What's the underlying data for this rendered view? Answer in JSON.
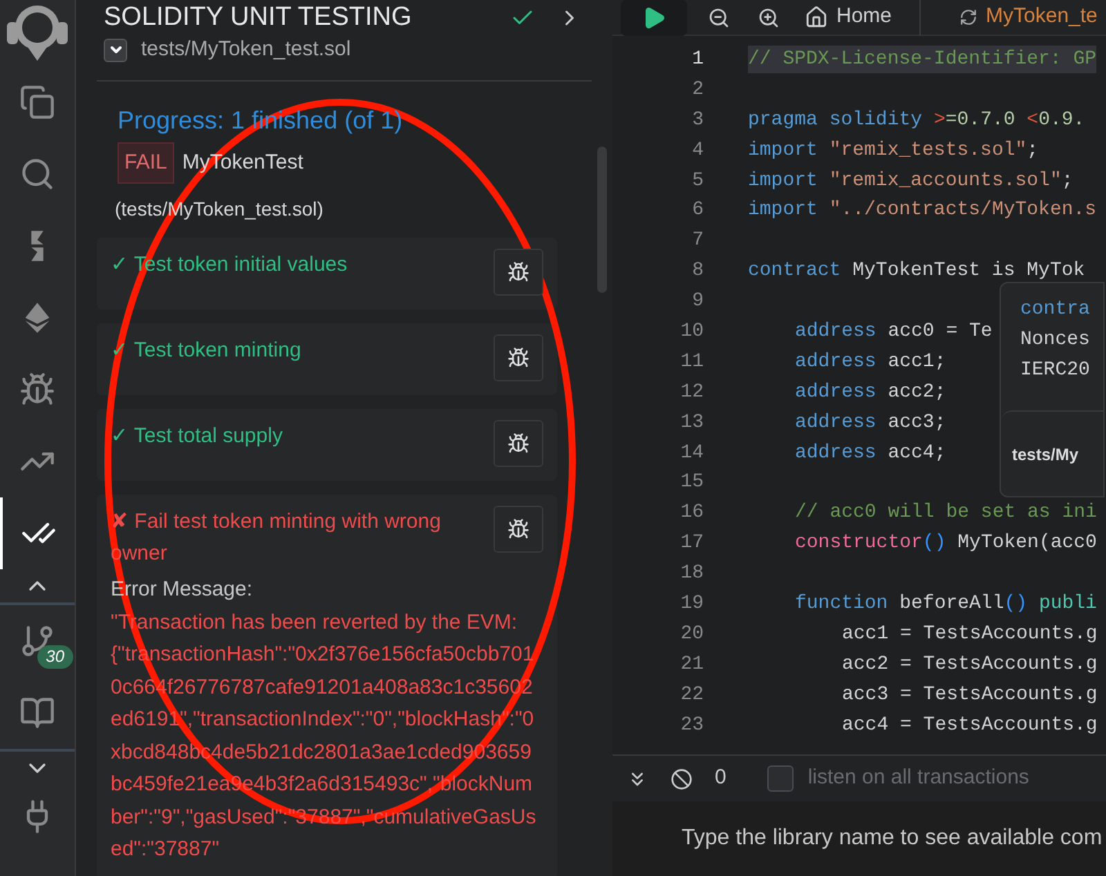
{
  "icon_bar": {
    "items": [
      {
        "selected": false
      },
      {
        "selected": false
      },
      {
        "selected": false
      },
      {
        "selected": false
      },
      {
        "selected": false
      },
      {
        "selected": false
      },
      {
        "selected": true
      },
      {
        "selected": false,
        "badge": "30"
      },
      {
        "selected": false
      }
    ]
  },
  "side_panel": {
    "title": "SOLIDITY UNIT TESTING",
    "test_file": {
      "label": "tests/MyToken_test.sol",
      "checked": true
    },
    "progress": "Progress: 1 finished (of 1)",
    "result": {
      "badge": "FAIL",
      "contract": "MyTokenTest",
      "file": "(tests/MyToken_test.sol)"
    },
    "tests": [
      {
        "kind": "pass",
        "mark": "✓",
        "label": "Test token initial values"
      },
      {
        "kind": "pass",
        "mark": "✓",
        "label": "Test token minting"
      },
      {
        "kind": "pass",
        "mark": "✓",
        "label": "Test total supply"
      },
      {
        "kind": "fail",
        "mark": "✘",
        "label": "Fail test token minting with wrong owner",
        "error_label": "Error Message:",
        "error": "\"Transaction has been reverted by the EVM: {\"transactionHash\":\"0x2f376e156cfa50cbb7010c664f26776787cafe91201a408a83c1c35602ed6191\",\"transactionIndex\":\"0\",\"blockHash\":\"0xbcd848bc4de5b21dc2801a3ae1cded903659bc459fe21ea9e4b3f2a6d315493c\",\"blockNumber\":\"9\",\"gasUsed\":\"37887\",\"cumulativeGasUsed\":\"37887\""
      }
    ]
  },
  "editor": {
    "tabs": [
      {
        "label": "Home",
        "selected": false
      },
      {
        "label": "MyToken_te",
        "selected": true
      }
    ],
    "lines": [
      {
        "number": "1",
        "kind": "top",
        "highlighted": true,
        "tokens": [
          {
            "kind": "comment",
            "text": "// SPDX-License-Identifier: GP"
          }
        ]
      },
      {
        "number": "2",
        "kind": "top",
        "highlighted": false
      },
      {
        "number": "3",
        "kind": "top",
        "highlighted": false,
        "tokens": [
          {
            "kind": "keyword",
            "text": "pragma"
          },
          {
            "kind": "keyword",
            "text": " solidity"
          },
          {
            "kind": "operator",
            "text": " >"
          },
          {
            "kind": "number",
            "text": "=0.7.0"
          },
          {
            "kind": "operator",
            "text": " <"
          },
          {
            "kind": "number",
            "text": "0.9."
          }
        ]
      },
      {
        "number": "4",
        "kind": "top",
        "highlighted": false,
        "tokens": [
          {
            "kind": "keyword",
            "text": "import"
          },
          {
            "kind": "string",
            "text": " \"remix_tests.sol\""
          },
          {
            "kind": "plain",
            "text": ";"
          }
        ]
      },
      {
        "number": "5",
        "kind": "top",
        "highlighted": false,
        "tokens": [
          {
            "kind": "keyword",
            "text": "import"
          },
          {
            "kind": "string",
            "text": " \"remix_accounts.sol\""
          },
          {
            "kind": "plain",
            "text": ";"
          }
        ]
      },
      {
        "number": "6",
        "kind": "top",
        "highlighted": false,
        "tokens": [
          {
            "kind": "keyword",
            "text": "import"
          },
          {
            "kind": "string",
            "text": " \"../contracts/MyToken.s"
          }
        ]
      },
      {
        "number": "7",
        "kind": "top",
        "highlighted": false
      },
      {
        "number": "8",
        "kind": "top",
        "highlighted": false,
        "tokens": [
          {
            "kind": "keyword",
            "text": "contract"
          },
          {
            "kind": "plain",
            "text": " MyTokenTest is MyTok"
          }
        ]
      },
      {
        "number": "9",
        "kind": "top",
        "highlighted": false
      },
      {
        "number": "10",
        "kind": "member",
        "highlighted": false,
        "tokens": [
          {
            "kind": "keyword",
            "text": "address"
          },
          {
            "kind": "plain",
            "text": " acc0 = Te"
          }
        ]
      },
      {
        "number": "11",
        "kind": "member",
        "highlighted": false,
        "tokens": [
          {
            "kind": "keyword",
            "text": "address"
          },
          {
            "kind": "plain",
            "text": " acc1;"
          }
        ]
      },
      {
        "number": "12",
        "kind": "member",
        "highlighted": false,
        "tokens": [
          {
            "kind": "keyword",
            "text": "address"
          },
          {
            "kind": "plain",
            "text": " acc2;"
          }
        ]
      },
      {
        "number": "13",
        "kind": "member",
        "highlighted": false,
        "tokens": [
          {
            "kind": "keyword",
            "text": "address"
          },
          {
            "kind": "plain",
            "text": " acc3;"
          }
        ]
      },
      {
        "number": "14",
        "kind": "member",
        "highlighted": false,
        "tokens": [
          {
            "kind": "keyword",
            "text": "address"
          },
          {
            "kind": "plain",
            "text": " acc4;"
          }
        ]
      },
      {
        "number": "15",
        "kind": "member",
        "highlighted": false
      },
      {
        "number": "16",
        "kind": "member",
        "highlighted": false,
        "tokens": [
          {
            "kind": "comment",
            "text": "// acc0 will be set as ini"
          }
        ]
      },
      {
        "number": "17",
        "kind": "member",
        "highlighted": false,
        "tokens": [
          {
            "kind": "special",
            "text": "constructor"
          },
          {
            "kind": "paren",
            "text": "()"
          },
          {
            "kind": "plain",
            "text": " MyToken(acc0"
          }
        ]
      },
      {
        "number": "18",
        "kind": "member",
        "highlighted": false
      },
      {
        "number": "19",
        "kind": "member",
        "highlighted": false,
        "tokens": [
          {
            "kind": "keyword",
            "text": "function"
          },
          {
            "kind": "plain",
            "text": " beforeAll"
          },
          {
            "kind": "paren",
            "text": "()"
          },
          {
            "kind": "modifier",
            "text": " publi"
          }
        ]
      },
      {
        "number": "20",
        "kind": "statement",
        "highlighted": false,
        "tokens": [
          {
            "kind": "plain",
            "text": "acc1 = TestsAccounts.g"
          }
        ]
      },
      {
        "number": "21",
        "kind": "statement",
        "highlighted": false,
        "tokens": [
          {
            "kind": "plain",
            "text": "acc2 = TestsAccounts.g"
          }
        ]
      },
      {
        "number": "22",
        "kind": "statement",
        "highlighted": false,
        "tokens": [
          {
            "kind": "plain",
            "text": "acc3 = TestsAccounts.g"
          }
        ]
      },
      {
        "number": "23",
        "kind": "statement",
        "highlighted": false,
        "tokens": [
          {
            "kind": "plain",
            "text": "acc4 = TestsAccounts.g"
          }
        ]
      }
    ],
    "hover_popup": {
      "lines": [
        {
          "kind": "keyword",
          "text": "contra"
        },
        {
          "kind": "plain",
          "text": "Nonces"
        },
        {
          "kind": "plain",
          "text": "IERC20"
        }
      ],
      "footer": "tests/My"
    }
  },
  "terminal": {
    "count": "0",
    "listen": {
      "label": "listen on all transactions",
      "checked": false
    },
    "placeholder": "Type the library name to see available com"
  }
}
